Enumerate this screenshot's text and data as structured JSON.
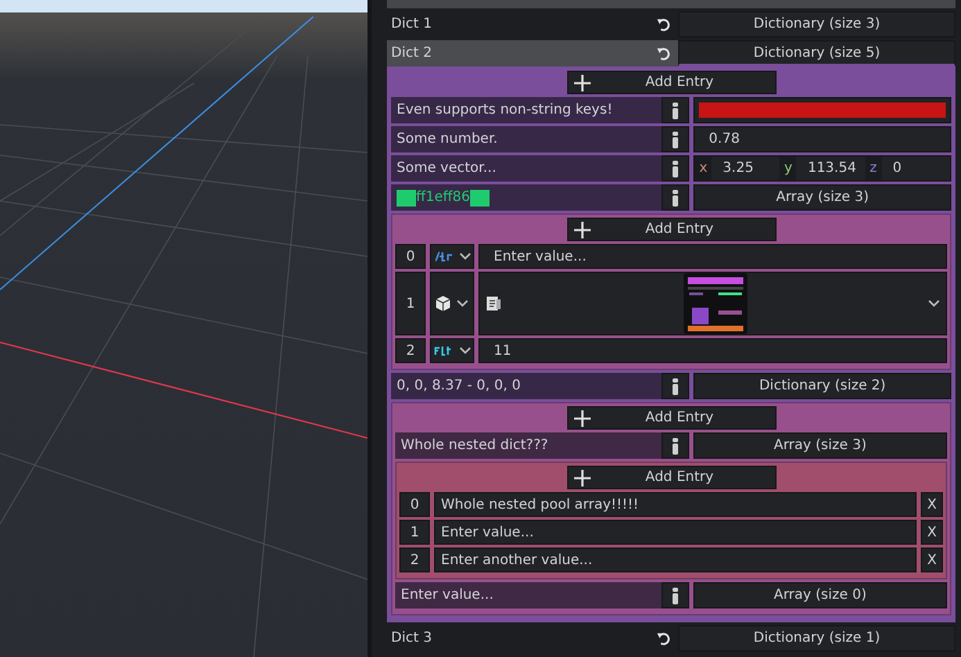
{
  "properties": [
    {
      "name": "Dict 1",
      "value": "Dictionary (size 3)",
      "highlighted": false,
      "expanded": false
    },
    {
      "name": "Dict 2",
      "value": "Dictionary (size 5)",
      "highlighted": true,
      "expanded": true,
      "editor": {
        "kind": "dict",
        "add_button": "Add Entry",
        "entries": [
          {
            "key": {
              "text": "Even supports non-string keys!"
            },
            "kind": "color",
            "color": "#c81414"
          },
          {
            "key": {
              "text": "Some number."
            },
            "kind": "number",
            "value": "0.78"
          },
          {
            "key": {
              "text": "Some vector..."
            },
            "kind": "vector",
            "vector": [
              {
                "axis": "x",
                "value": "3.25"
              },
              {
                "axis": "y",
                "value": "113.54"
              },
              {
                "axis": "z",
                "value": "0"
              }
            ]
          },
          {
            "key": {
              "text": "ff1eff86",
              "color": "#1ecc6e"
            },
            "kind": "collection",
            "value": "Array (size 3)",
            "nested": {
              "kind": "array",
              "add_button": "Add Entry",
              "items": [
                {
                  "index": "0",
                  "kind": "string",
                  "value": "Enter value..."
                },
                {
                  "index": "1",
                  "kind": "object"
                },
                {
                  "index": "2",
                  "kind": "float",
                  "value": "11"
                }
              ]
            }
          },
          {
            "key": {
              "text": "0, 0, 8.37 - 0, 0, 0"
            },
            "kind": "collection",
            "value": "Dictionary (size 2)",
            "nested": {
              "kind": "dict",
              "add_button": "Add Entry",
              "entries": [
                {
                  "key": {
                    "text": "Whole nested dict???"
                  },
                  "kind": "collection",
                  "value": "Array (size 3)",
                  "nested": {
                    "kind": "array",
                    "add_button": "Add Entry",
                    "items": [
                      {
                        "index": "0",
                        "kind": "pool",
                        "value": "Whole nested pool array!!!!!",
                        "delete": "X"
                      },
                      {
                        "index": "1",
                        "kind": "pool",
                        "value": "Enter value...",
                        "delete": "X"
                      },
                      {
                        "index": "2",
                        "kind": "pool",
                        "value": "Enter another value...",
                        "delete": "X"
                      }
                    ]
                  }
                },
                {
                  "key": {
                    "text": "Enter value..."
                  },
                  "kind": "collection",
                  "value": "Array (size 0)"
                }
              ]
            }
          }
        ]
      }
    },
    {
      "name": "Dict 3",
      "value": "Dictionary (size 1)",
      "highlighted": false,
      "expanded": false
    }
  ]
}
